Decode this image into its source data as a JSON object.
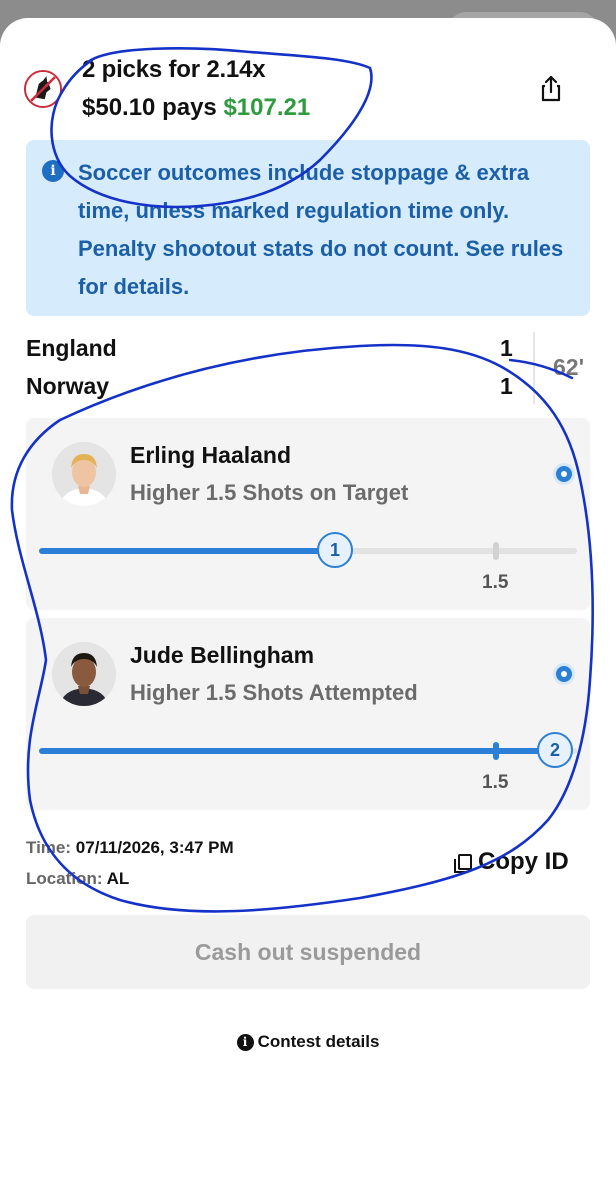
{
  "header": {
    "title": "2 picks for 2.14x",
    "entry": "$50.10 pays",
    "payout": "$107.21",
    "share_icon": "share-icon",
    "logo_icon": "app-logo"
  },
  "banner": {
    "icon": "info-icon",
    "message": "Soccer outcomes include stoppage & extra time, unless marked regulation time only. Penalty shootout stats do not count. See rules for details."
  },
  "match": {
    "home": "England",
    "away": "Norway",
    "home_score": "1",
    "away_score": "1",
    "clock": "62'"
  },
  "picks": [
    {
      "player": "Erling Haaland",
      "pick": "Higher 1.5 Shots on Target",
      "current": "1",
      "line": "1.5",
      "progress_fraction": 0.55,
      "line_fraction": 0.85
    },
    {
      "player": "Jude Bellingham",
      "pick": "Higher 1.5 Shots Attempted",
      "current": "2",
      "line": "1.5",
      "progress_fraction": 0.96,
      "line_fraction": 0.85
    }
  ],
  "details": {
    "time_label": "Time:",
    "time_value": "07/11/2026, 3:47 PM",
    "location_label": "Location:",
    "location_value": "AL",
    "copy_id": "Copy ID"
  },
  "cashout_label": "Cash out suspended",
  "contest_label": "Contest details",
  "colors": {
    "accent": "#2c7fd6",
    "payout_green": "#2e9b3e",
    "banner_bg": "#d6ebfb",
    "annotation_ink": "#1432c8"
  }
}
